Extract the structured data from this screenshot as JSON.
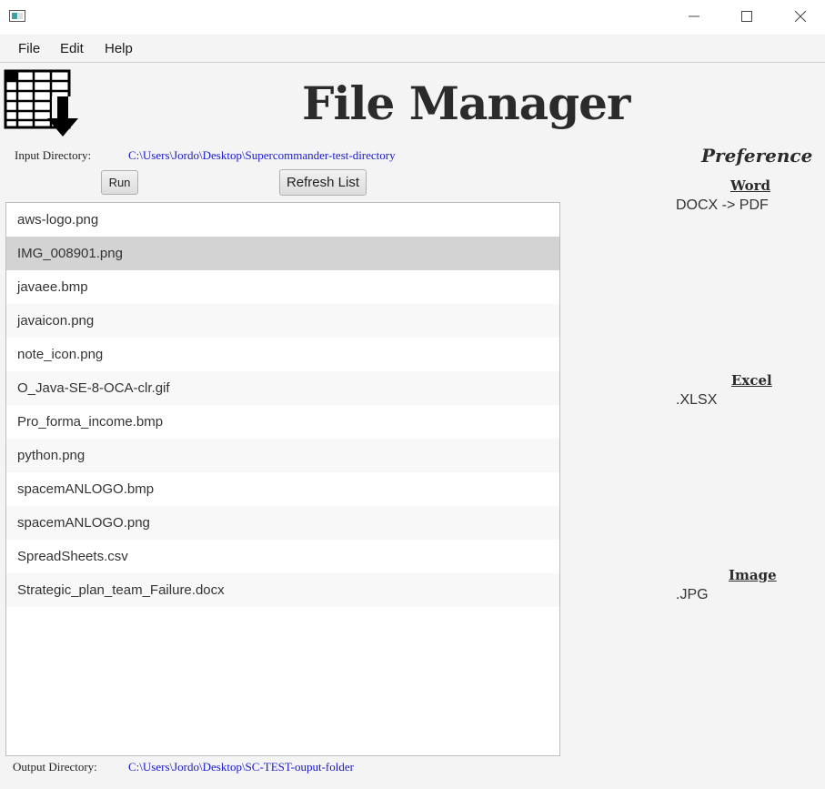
{
  "window": {
    "icon": "window-app-icon",
    "controls": {
      "minimize_icon": "minimize-icon",
      "maximize_icon": "maximize-icon",
      "close_icon": "close-icon"
    }
  },
  "menu": {
    "items": [
      "File",
      "Edit",
      "Help"
    ]
  },
  "header": {
    "title": "File Manager",
    "logo_icon": "spreadsheet-download-icon"
  },
  "input_directory": {
    "label": "Input Directory:",
    "value": "C:\\Users\\Jordo\\Desktop\\Supercommander-test-directory"
  },
  "buttons": {
    "run": "Run",
    "refresh": "Refresh List"
  },
  "files": [
    "aws-logo.png",
    "IMG_008901.png",
    "javaee.bmp",
    "javaicon.png",
    "note_icon.png",
    "O_Java-SE-8-OCA-clr.gif",
    "Pro_forma_income.bmp",
    "python.png",
    "spacemANLOGO.bmp",
    "spacemANLOGO.png",
    "SpreadSheets.csv",
    "Strategic_plan_team_Failure.docx"
  ],
  "selected_file": "IMG_008901.png",
  "output_directory": {
    "label": "Output Directory:",
    "value": "C:\\Users\\Jordo\\Desktop\\SC-TEST-ouput-folder"
  },
  "preference": {
    "title": "Preference",
    "word": {
      "heading": "Word",
      "value": "DOCX -> PDF"
    },
    "excel": {
      "heading": "Excel",
      "value": ".XLSX"
    },
    "image": {
      "heading": "Image",
      "value": ".JPG"
    }
  },
  "colors": {
    "path_text": "#1a1acc",
    "selected_row": "#d3d3d3",
    "background": "#f4f4f4"
  }
}
